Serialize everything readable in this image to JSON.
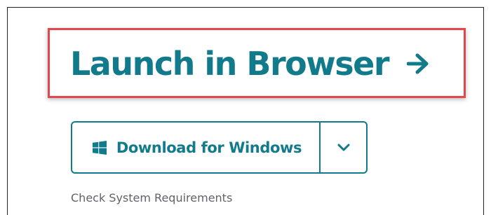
{
  "launch": {
    "label": "Launch in Browser"
  },
  "download": {
    "label": "Download for Windows",
    "icon": "windows-icon",
    "dropdown_icon": "chevron-down-icon"
  },
  "system_requirements": {
    "label": "Check System Requirements"
  },
  "colors": {
    "accent": "#117a8b",
    "highlight_border": "#e2474b",
    "muted_text": "#5f6368"
  }
}
